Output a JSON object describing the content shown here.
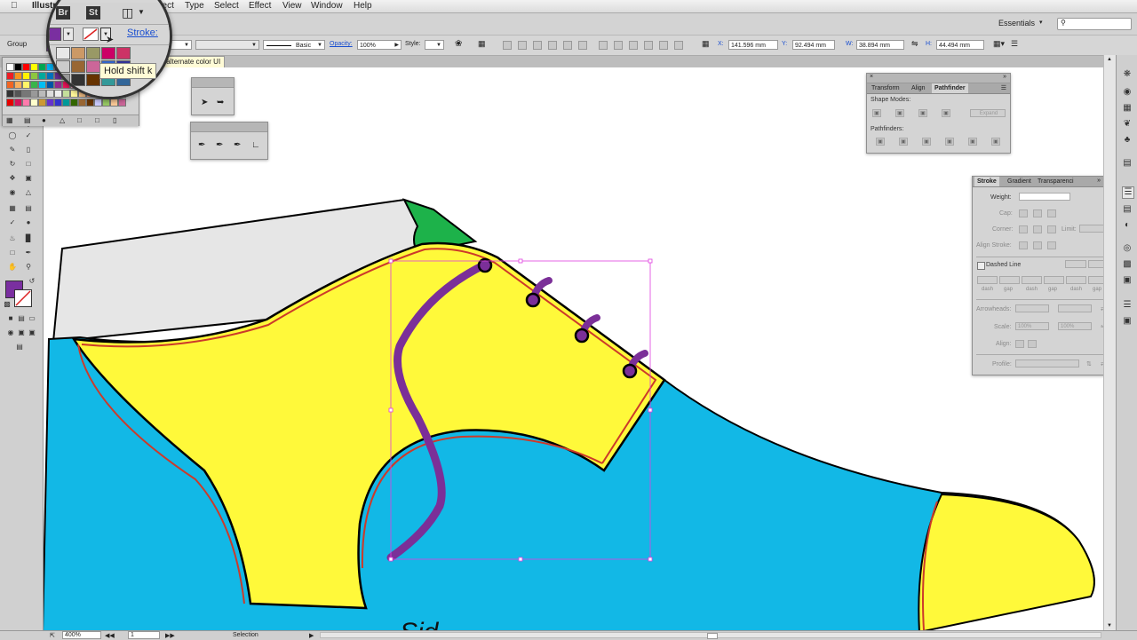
{
  "menubar": {
    "app_name": "Illustra",
    "items": [
      "Object",
      "Type",
      "Select",
      "Effect",
      "View",
      "Window",
      "Help"
    ]
  },
  "appbar": {
    "workspace": "Essentials",
    "bridge_label": "Br",
    "stock_label": "St"
  },
  "control": {
    "selection_type": "Group",
    "stroke_label": "Stroke:",
    "brush_label": "Basic",
    "opacity_label": "Opacity:",
    "opacity_value": "100%",
    "style_label": "Style:",
    "x_label": "X:",
    "x_value": "141.596 mm",
    "y_label": "Y:",
    "y_value": "92.494 mm",
    "w_label": "W:",
    "w_value": "38.894 mm",
    "h_label": "H:",
    "h_value": "44.494 mm"
  },
  "tooltip": {
    "text": "Hold shift k",
    "overflow_text": "ng up alternate color UI"
  },
  "pathfinder": {
    "tabs": [
      "Transform",
      "Align",
      "Pathfinder"
    ],
    "shape_modes_label": "Shape Modes:",
    "expand_label": "Expand",
    "pathfinders_label": "Pathfinders:"
  },
  "stroke_panel": {
    "tabs": [
      "Stroke",
      "Gradient",
      "Transparenci"
    ],
    "weight_label": "Weight:",
    "cap_label": "Cap:",
    "corner_label": "Corner:",
    "limit_label": "Limit:",
    "limit_unit": "x",
    "align_label": "Align Stroke:",
    "dashed_label": "Dashed Line",
    "dash_labels": [
      "dash",
      "gap",
      "dash",
      "gap",
      "dash",
      "gap"
    ],
    "arrowheads_label": "Arrowheads:",
    "scale_label": "Scale:",
    "scale_value_1": "100%",
    "scale_value_2": "100%",
    "align_arrow_label": "Align:",
    "profile_label": "Profile:"
  },
  "status": {
    "zoom": "400%",
    "artboard": "1",
    "tool": "Selection"
  },
  "colors": {
    "shoe_yellow": "#fff93a",
    "shoe_blue": "#12b8e6",
    "shoe_grey": "#e6e6e6",
    "tongue_green": "#1db24a",
    "lace_purple": "#7b2f98",
    "stitch_red": "#cc3a2a",
    "selection_magenta": "#e040e0",
    "fill_swatch": "#7a2fa0"
  },
  "canvas": {
    "partial_text": "Sid"
  }
}
